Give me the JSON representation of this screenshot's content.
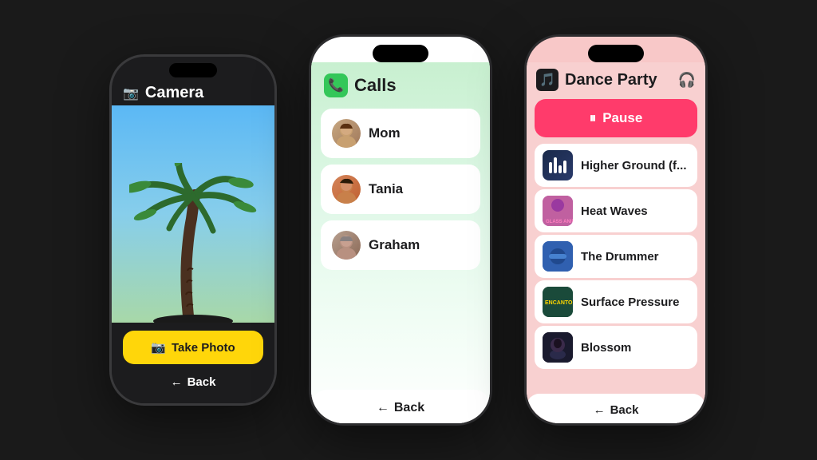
{
  "phone1": {
    "title": "Camera",
    "take_photo_label": "Take Photo",
    "back_label": "Back"
  },
  "phone2": {
    "title": "Calls",
    "back_label": "Back",
    "contacts": [
      {
        "name": "Mom",
        "avatar": "mom"
      },
      {
        "name": "Tania",
        "avatar": "tania"
      },
      {
        "name": "Graham",
        "avatar": "graham"
      }
    ]
  },
  "phone3": {
    "title": "Dance Party",
    "pause_label": "Pause",
    "back_label": "Back",
    "songs": [
      {
        "name": "Higher Ground (f...",
        "thumb_class": "thumb-higher",
        "icon": "bars"
      },
      {
        "name": "Heat Waves",
        "thumb_class": "thumb-heatwaves",
        "icon": "img"
      },
      {
        "name": "The Drummer",
        "thumb_class": "thumb-drummer",
        "icon": "img"
      },
      {
        "name": "Surface Pressure",
        "thumb_class": "thumb-surface",
        "icon": "img"
      },
      {
        "name": "Blossom",
        "thumb_class": "thumb-blossom",
        "icon": "img"
      }
    ]
  }
}
